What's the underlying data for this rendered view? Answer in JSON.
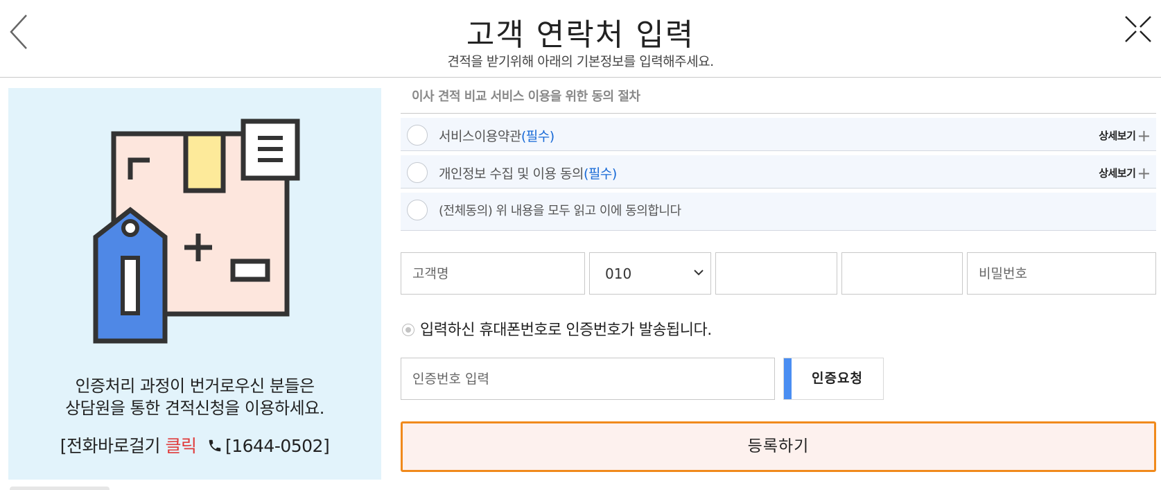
{
  "header": {
    "title": "고객 연락처 입력",
    "subtitle": "견적을 받기위해 아래의 기본정보를 입력해주세요."
  },
  "left_panel": {
    "message_line1": "인증처리 과정이 번거로우신 분들은",
    "message_line2": "상담원을 통한 견적신청을 이용하세요.",
    "call_prefix": "[전화바로걸기 ",
    "call_click": "클릭",
    "call_number": "[1644-0502]"
  },
  "consent": {
    "heading": "이사 견적 비교 서비스 이용을 위한 동의 절차",
    "items": [
      {
        "label": "서비스이용약관",
        "required": "(필수)",
        "detail": "상세보기"
      },
      {
        "label": "개인정보 수집 및 이용 동의",
        "required": "(필수)",
        "detail": "상세보기"
      }
    ],
    "all_agree": "(전체동의) 위 내용을 모두 읽고 이에 동의합니다"
  },
  "form": {
    "name_placeholder": "고객명",
    "phone_prefix": "010",
    "password_placeholder": "비밀번호",
    "notice": "입력하신 휴대폰번호로 인증번호가 발송됩니다.",
    "auth_placeholder": "인증번호 입력",
    "auth_button": "인증요청",
    "submit_button": "등록하기"
  },
  "colors": {
    "panel_bg": "#e2f3fb",
    "required_blue": "#1769d6",
    "agree_red": "#c8102e",
    "submit_border": "#f08a1c",
    "auth_accent": "#4a8ef2"
  },
  "icons": {
    "back": "chevron-left-icon",
    "close": "close-icon",
    "phone": "phone-icon",
    "illustration": "box-info-tag-icon"
  }
}
